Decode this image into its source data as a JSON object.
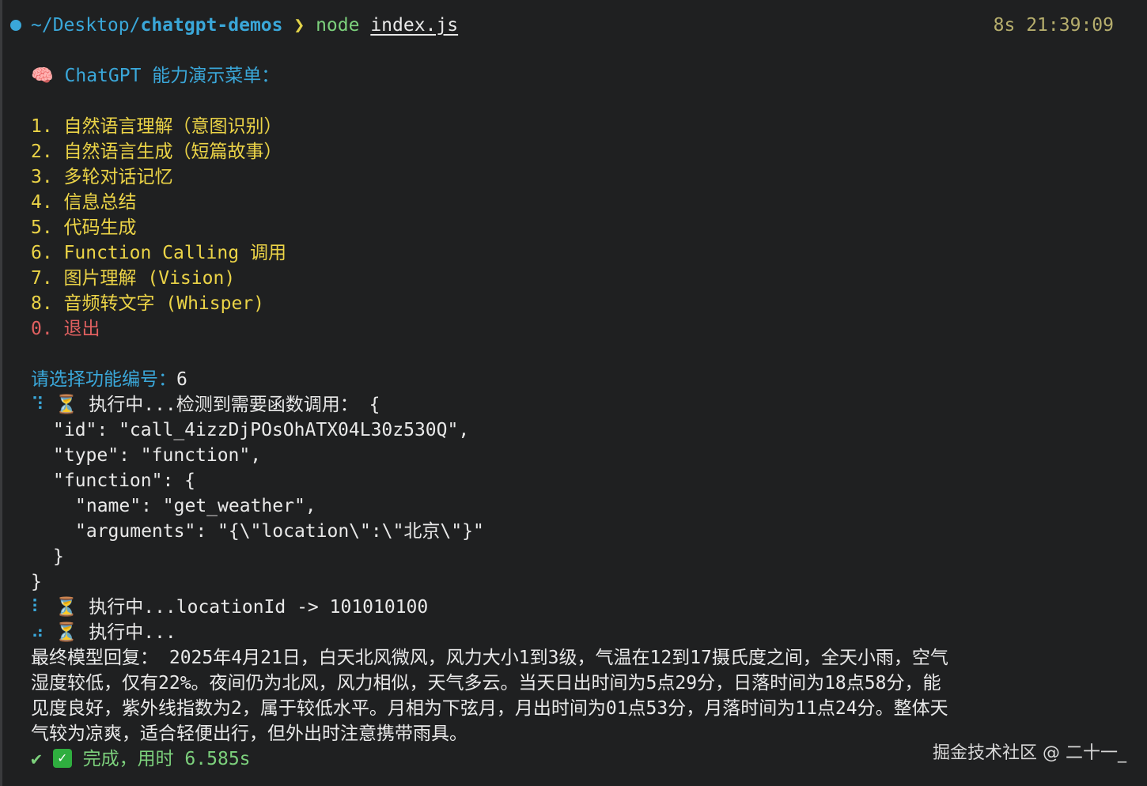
{
  "prompt": {
    "path_prefix": "~/Desktop/",
    "path_dir": "chatgpt-demos",
    "arrow": "❯",
    "command": "node",
    "argument": "index.js",
    "timer": "8s 21:39:09",
    "dot_color": "#3aa7d9"
  },
  "menu": {
    "icon": "🧠",
    "title": "ChatGPT 能力演示菜单：",
    "items": [
      "1. 自然语言理解（意图识别）",
      "2. 自然语言生成（短篇故事）",
      "3. 多轮对话记忆",
      "4. 信息总结",
      "5. 代码生成",
      "6. Function Calling 调用",
      "7. 图片理解 (Vision)",
      "8. 音频转文字 (Whisper)",
      "0. 退出"
    ]
  },
  "input": {
    "label": "请选择功能编号：",
    "value": "6"
  },
  "execution": {
    "spinner1": "⠹",
    "hourglass": "⏳",
    "line1": "执行中...检测到需要函数调用： {",
    "json_lines": [
      "\"id\": \"call_4izzDjPOsOhATX04L30z530Q\",",
      "\"type\": \"function\",",
      "\"function\": {",
      "\"name\": \"get_weather\",",
      "\"arguments\": \"{\\\"location\\\":\\\"北京\\\"}\"",
      "}",
      "}"
    ],
    "spinner2": "⠇",
    "line2": "执行中...locationId -> 101010100",
    "spinner3": "⠴",
    "line3": "执行中..."
  },
  "final_reply": {
    "lines": [
      "最终模型回复： 2025年4月21日，白天北风微风，风力大小1到3级，气温在12到17摄氏度之间，全天小雨，空气",
      "湿度较低，仅有22%。夜间仍为北风，风力相似，天气多云。当天日出时间为5点29分，日落时间为18点58分，能",
      "见度良好，紫外线指数为2，属于较低水平。月相为下弦月，月出时间为01点53分，月落时间为11点24分。整体天",
      "气较为凉爽，适合轻便出行，但外出时注意携带雨具。"
    ]
  },
  "completion": {
    "tick": "✔",
    "check": "✓",
    "check_color": "#2fae3f",
    "text": "完成，用时 6.585s"
  },
  "watermark": "掘金技术社区 @ 二十一_"
}
